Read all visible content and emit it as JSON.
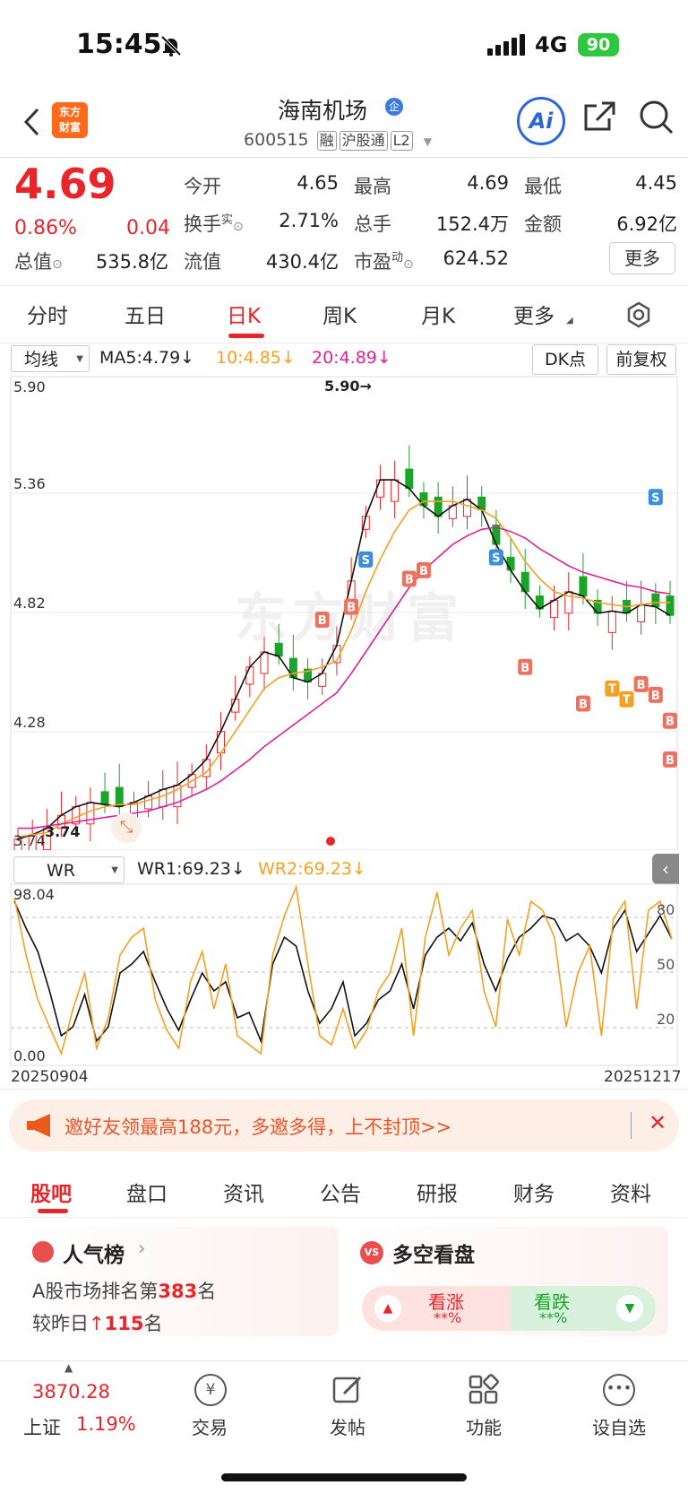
{
  "status": {
    "time": "15:45",
    "network": "4G",
    "battery": "90"
  },
  "header": {
    "logo_line1": "东方",
    "logo_line2": "财富",
    "stock_name": "海南机场",
    "stock_name_badge": "企",
    "stock_code": "600515",
    "tags": [
      "融",
      "沪股通",
      "L2"
    ],
    "ai_label": "Ai"
  },
  "quote": {
    "price": "4.69",
    "change_pct": "0.86%",
    "change": "0.04",
    "open_label": "今开",
    "open": "4.65",
    "high_label": "最高",
    "high": "4.69",
    "low_label": "最低",
    "low": "4.45",
    "turnover_label": "换手",
    "turnover_sup": "实",
    "turnover": "2.71%",
    "volume_label": "总手",
    "volume": "152.4万",
    "amount_label": "金额",
    "amount": "6.92亿",
    "mktcap_label": "总值",
    "mktcap": "535.8亿",
    "float_label": "流值",
    "float": "430.4亿",
    "pe_label": "市盈",
    "pe_sup": "动",
    "pe": "624.52",
    "more_label": "更多"
  },
  "period_tabs": [
    "分时",
    "五日",
    "日K",
    "周K",
    "月K",
    "更多"
  ],
  "active_period": "日K",
  "indicator_bar": {
    "select": "均线",
    "ma5": "MA5:4.79↓",
    "ma10": "10:4.85↓",
    "ma20": "20:4.89↓",
    "dk": "DK点",
    "adjust": "前复权"
  },
  "kline": {
    "y_ticks": [
      "5.90",
      "5.36",
      "4.82",
      "4.28",
      "3.74"
    ],
    "max_label": "5.90→",
    "min_label": "3.74",
    "watermark": "东方财富"
  },
  "wr": {
    "select": "WR",
    "wr1": "WR1:69.23↓",
    "wr2": "WR2:69.23↓",
    "top_val": "98.04",
    "bottom_val": "0.00",
    "levels": [
      "80",
      "50",
      "20"
    ],
    "date_start": "20250904",
    "date_end": "20251217"
  },
  "chart_data": [
    {
      "type": "line",
      "title": "",
      "xlabel": "",
      "ylabel": "",
      "ylim": [
        3.74,
        5.9
      ],
      "x_range": [
        "20250904",
        "20251217"
      ],
      "series": [
        {
          "name": "MA5",
          "values": [
            3.75,
            3.77,
            3.8,
            3.86,
            3.9,
            3.92,
            3.91,
            3.9,
            3.92,
            3.95,
            3.98,
            4.0,
            4.05,
            4.12,
            4.25,
            4.4,
            4.55,
            4.62,
            4.6,
            4.5,
            4.48,
            4.52,
            4.65,
            4.95,
            5.25,
            5.42,
            5.42,
            5.38,
            5.3,
            5.25,
            5.3,
            5.33,
            5.28,
            5.12,
            5.0,
            4.9,
            4.82,
            4.86,
            4.9,
            4.88,
            4.8,
            4.81,
            4.8,
            4.84,
            4.83,
            4.79
          ]
        },
        {
          "name": "MA10",
          "values": [
            3.76,
            3.77,
            3.78,
            3.82,
            3.85,
            3.88,
            3.9,
            3.91,
            3.91,
            3.93,
            3.95,
            3.98,
            4.02,
            4.06,
            4.15,
            4.25,
            4.35,
            4.45,
            4.5,
            4.52,
            4.53,
            4.55,
            4.58,
            4.72,
            4.9,
            5.05,
            5.18,
            5.28,
            5.32,
            5.32,
            5.32,
            5.3,
            5.28,
            5.24,
            5.15,
            5.04,
            4.96,
            4.9,
            4.88,
            4.87,
            4.85,
            4.84,
            4.83,
            4.84,
            4.85,
            4.85
          ]
        },
        {
          "name": "MA20",
          "values": [
            3.8,
            3.8,
            3.81,
            3.82,
            3.83,
            3.84,
            3.85,
            3.86,
            3.87,
            3.88,
            3.9,
            3.92,
            3.95,
            3.98,
            4.02,
            4.07,
            4.12,
            4.18,
            4.23,
            4.28,
            4.33,
            4.38,
            4.43,
            4.52,
            4.62,
            4.72,
            4.82,
            4.92,
            5.0,
            5.06,
            5.12,
            5.16,
            5.19,
            5.2,
            5.18,
            5.15,
            5.1,
            5.06,
            5.02,
            4.99,
            4.97,
            4.95,
            4.93,
            4.92,
            4.9,
            4.89
          ]
        }
      ]
    },
    {
      "type": "line",
      "title": "",
      "xlabel": "",
      "ylabel": "",
      "ylim": [
        0,
        98.04
      ],
      "series": [
        {
          "name": "WR1",
          "values": [
            90,
            75,
            62,
            40,
            15,
            20,
            38,
            12,
            20,
            50,
            55,
            62,
            45,
            30,
            18,
            35,
            50,
            40,
            45,
            25,
            28,
            12,
            55,
            70,
            65,
            40,
            22,
            30,
            45,
            15,
            22,
            35,
            40,
            55,
            30,
            60,
            70,
            75,
            68,
            78,
            55,
            40,
            58,
            70,
            75,
            82,
            80,
            68,
            72,
            65,
            50,
            75,
            85,
            62,
            72,
            82,
            69
          ]
        },
        {
          "name": "WR2",
          "values": [
            92,
            60,
            35,
            20,
            5,
            30,
            50,
            8,
            25,
            60,
            70,
            75,
            35,
            18,
            8,
            45,
            62,
            30,
            55,
            15,
            10,
            5,
            60,
            82,
            98,
            55,
            15,
            10,
            30,
            8,
            18,
            40,
            50,
            75,
            15,
            70,
            95,
            60,
            75,
            85,
            40,
            20,
            80,
            60,
            90,
            85,
            70,
            20,
            50,
            65,
            15,
            80,
            90,
            30,
            85,
            90,
            69
          ]
        }
      ]
    }
  ],
  "signals": [
    "B",
    "S",
    "T"
  ],
  "banner": {
    "text": "邀好友领最高188元，多邀多得，上不封顶>>"
  },
  "bottom_tabs": [
    "股吧",
    "盘口",
    "资讯",
    "公告",
    "研报",
    "财务",
    "资料"
  ],
  "active_bottom_tab": "股吧",
  "cards": {
    "popularity": {
      "title": "人气榜",
      "line1_prefix": "A股市场排名第",
      "rank": "383",
      "line1_suffix": "名",
      "line2_prefix": "较昨日",
      "change": "115",
      "line2_suffix": "名"
    },
    "sentiment": {
      "title": "多空看盘",
      "bull_label": "看涨",
      "bull_val": "**%",
      "bear_label": "看跌",
      "bear_val": "**%"
    }
  },
  "nav": {
    "index_value": "3870.28",
    "index_name": "上证",
    "index_change": "1.19%",
    "items": [
      "交易",
      "发帖",
      "功能",
      "设自选"
    ]
  }
}
